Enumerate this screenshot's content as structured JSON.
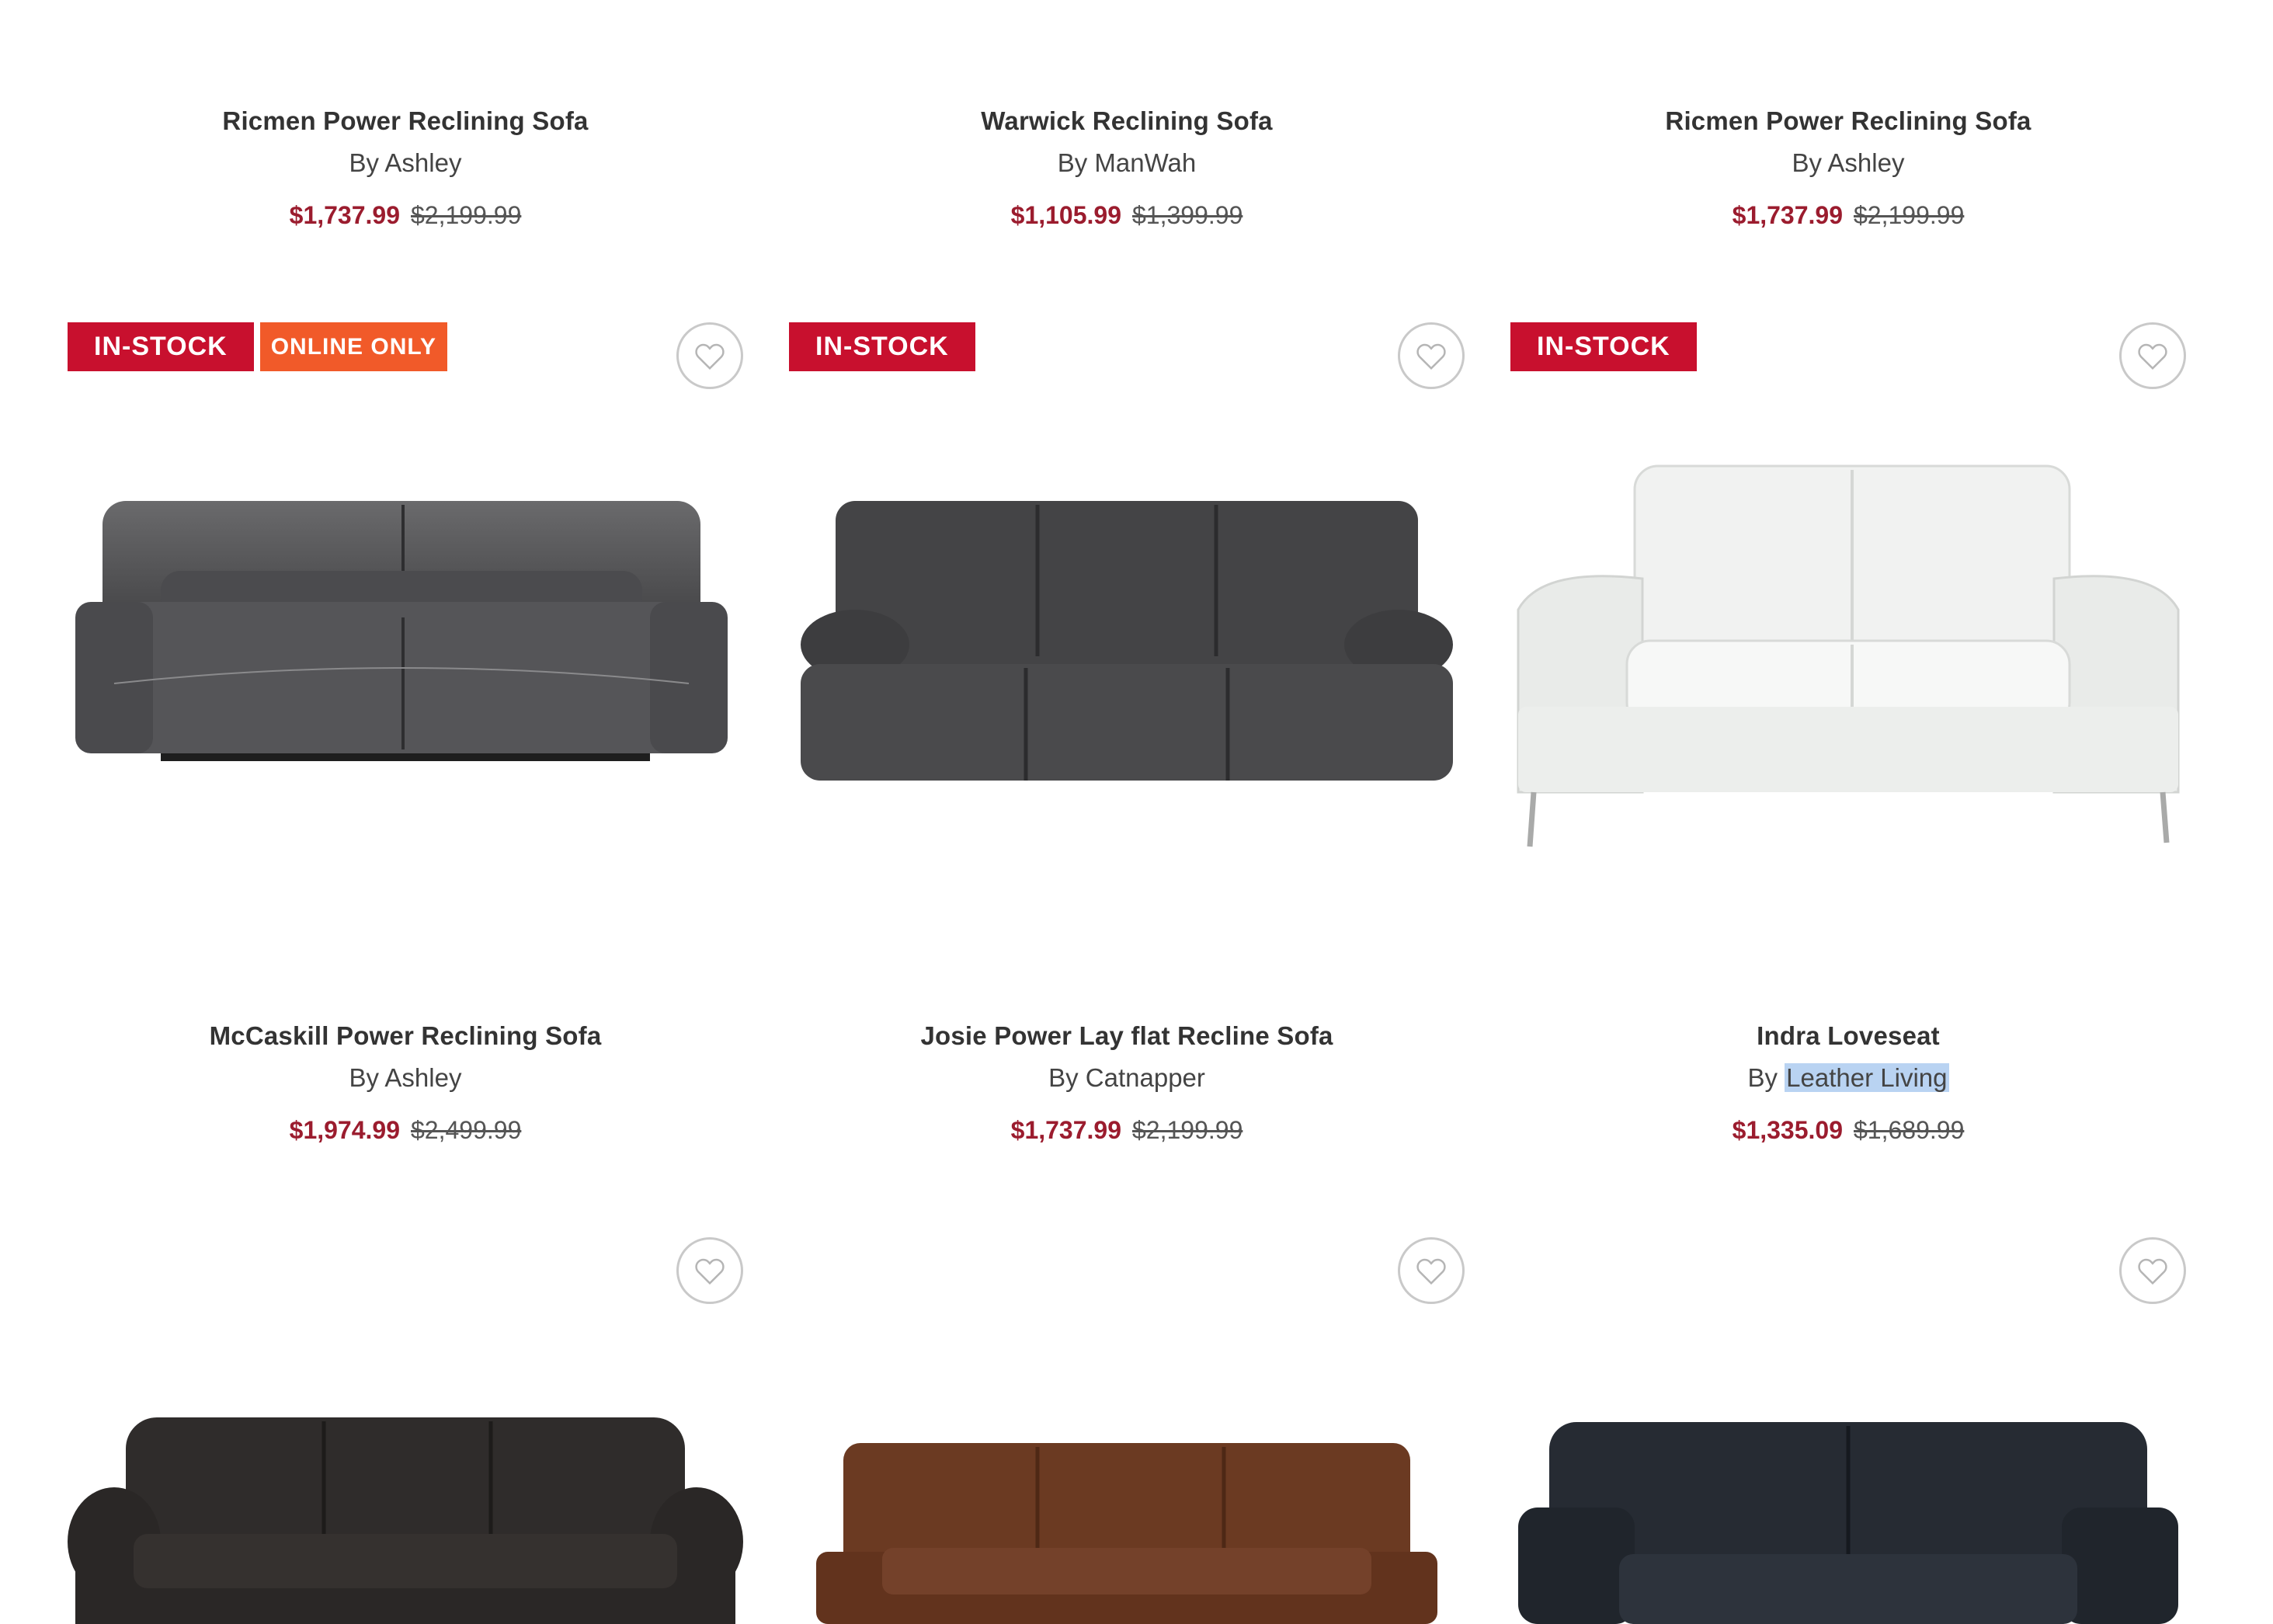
{
  "row1": [
    {
      "name": "Ricmen Power Reclining Sofa",
      "brand_prefix": "By",
      "brand": "Ashley",
      "sale": "$1,737.99",
      "orig": "$2,199.99"
    },
    {
      "name": "Warwick Reclining Sofa",
      "brand_prefix": "By",
      "brand": "ManWah",
      "sale": "$1,105.99",
      "orig": "$1,399.99"
    },
    {
      "name": "Ricmen Power Reclining Sofa",
      "brand_prefix": "By",
      "brand": "Ashley",
      "sale": "$1,737.99",
      "orig": "$2,199.99"
    }
  ],
  "row2": [
    {
      "name": "McCaskill Power Reclining Sofa",
      "brand_prefix": "By",
      "brand": "Ashley",
      "sale": "$1,974.99",
      "orig": "$2,499.99",
      "badge_stock": "IN-STOCK",
      "badge_online": "ONLINE ONLY",
      "image_icon": "gray-leather-reclining-sofa"
    },
    {
      "name": "Josie Power Lay flat Recline Sofa",
      "brand_prefix": "By",
      "brand": "Catnapper",
      "sale": "$1,737.99",
      "orig": "$2,199.99",
      "badge_stock": "IN-STOCK",
      "image_icon": "charcoal-fabric-reclining-sofa"
    },
    {
      "name": "Indra Loveseat",
      "brand_prefix": "By",
      "brand": "Leather Living",
      "sale": "$1,335.09",
      "orig": "$1,689.99",
      "badge_stock": "IN-STOCK",
      "image_icon": "white-leather-loveseat"
    }
  ],
  "row3": [
    {
      "image_icon": "dark-leather-rolled-arm-sofa"
    },
    {
      "image_icon": "brown-leather-sofa"
    },
    {
      "image_icon": "navy-leather-loveseat"
    }
  ],
  "icons": {
    "favorite": "heart-outline-icon"
  },
  "colors": {
    "sale_price": "#9b1c2e",
    "in_stock_badge": "#c8102e",
    "online_badge": "#f15a29",
    "brand_highlight": "#b9d3f2"
  }
}
